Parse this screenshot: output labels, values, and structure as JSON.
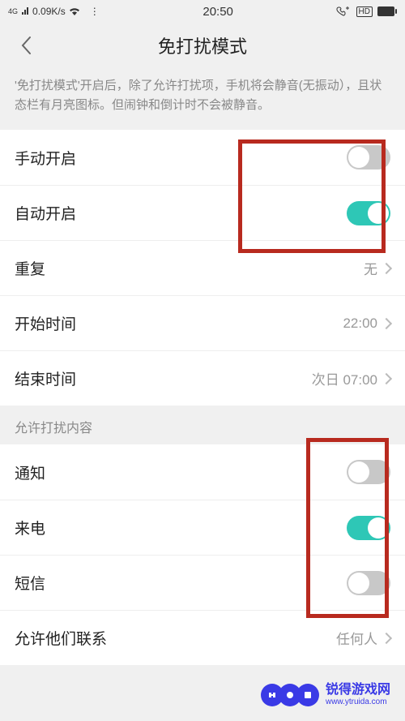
{
  "status": {
    "network_type": "4G",
    "speed": "0.09K/s",
    "time": "20:50",
    "hd": "HD",
    "dots": "⋮"
  },
  "header": {
    "title": "免打扰模式"
  },
  "description": "'免打扰模式'开启后，除了允许打扰项，手机将会静音(无振动），且状态栏有月亮图标。但闹钟和倒计时不会被静音。",
  "rows": {
    "manual": {
      "label": "手动开启",
      "on": false
    },
    "auto": {
      "label": "自动开启",
      "on": true
    },
    "repeat": {
      "label": "重复",
      "value": "无"
    },
    "start": {
      "label": "开始时间",
      "value": "22:00"
    },
    "end": {
      "label": "结束时间",
      "value": "次日 07:00"
    }
  },
  "section2": {
    "header": "允许打扰内容",
    "notify": {
      "label": "通知",
      "on": false
    },
    "call": {
      "label": "来电",
      "on": true
    },
    "sms": {
      "label": "短信",
      "on": false
    },
    "allow": {
      "label": "允许他们联系",
      "value": "任何人"
    }
  },
  "watermark": {
    "brand": "锐得游戏网",
    "url": "www.ytruida.com"
  }
}
